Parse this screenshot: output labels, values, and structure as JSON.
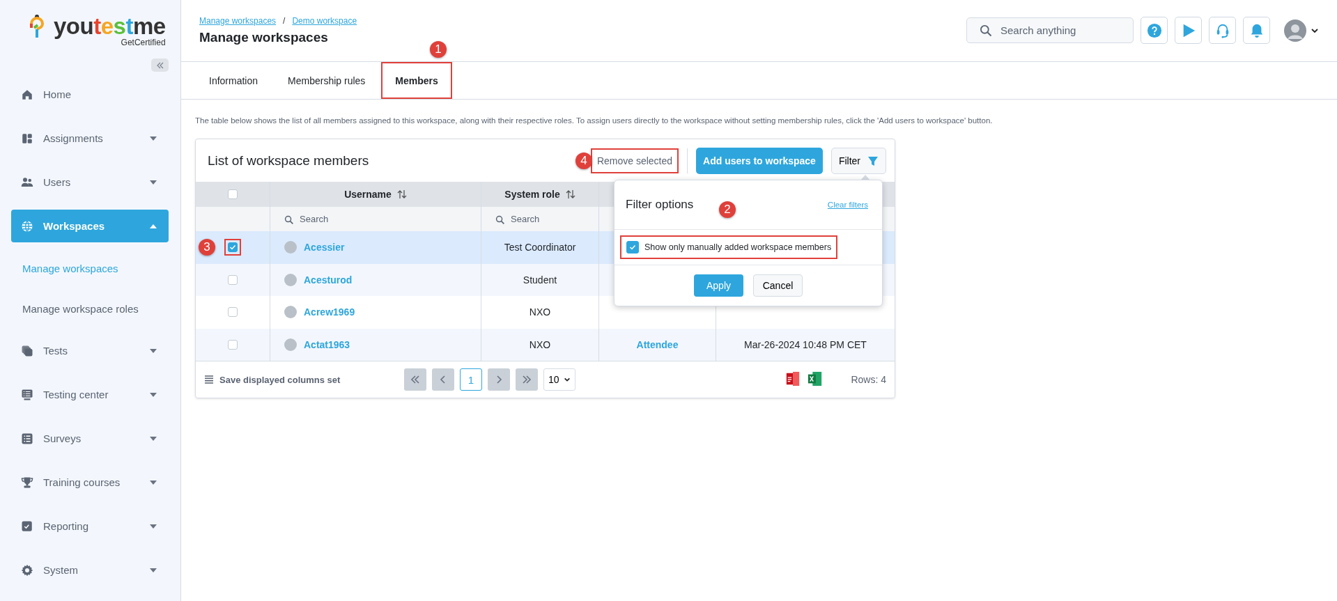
{
  "sidebar": {
    "logo": {
      "wordmark": "youtestme",
      "tagline": "GetCertified"
    },
    "items": [
      {
        "label": "Home",
        "selected": false
      },
      {
        "label": "Assignments",
        "selected": false,
        "expanded": false
      },
      {
        "label": "Users",
        "selected": false,
        "expanded": false
      },
      {
        "label": "Workspaces",
        "selected": true,
        "expanded": true,
        "children": [
          {
            "label": "Manage workspaces",
            "selected": true
          },
          {
            "label": "Manage workspace roles",
            "selected": false
          }
        ]
      },
      {
        "label": "Tests",
        "selected": false,
        "expanded": false
      },
      {
        "label": "Testing center",
        "selected": false,
        "expanded": false
      },
      {
        "label": "Surveys",
        "selected": false,
        "expanded": false
      },
      {
        "label": "Training courses",
        "selected": false,
        "expanded": false
      },
      {
        "label": "Reporting",
        "selected": false,
        "expanded": false
      },
      {
        "label": "System",
        "selected": false,
        "expanded": false
      }
    ]
  },
  "header": {
    "breadcrumbs": [
      "Manage workspaces",
      "Demo workspace"
    ],
    "separator": "/",
    "title": "Manage workspaces",
    "search": {
      "placeholder": "Search anything"
    }
  },
  "tabs": [
    {
      "label": "Information",
      "selected": false,
      "highlighted": false
    },
    {
      "label": "Membership rules",
      "selected": false,
      "highlighted": false
    },
    {
      "label": "Members",
      "selected": true,
      "highlighted": true
    }
  ],
  "description": "The table below shows the list of all members assigned to this workspace, along with their respective roles. To assign users directly to the workspace without setting membership rules, click the 'Add users to workspace' button.",
  "members_card": {
    "title": "List of workspace members",
    "remove_button": {
      "label": "Remove selected",
      "highlighted": true
    },
    "add_button": "Add users to workspace",
    "filter_button": "Filter",
    "table": {
      "header_checkbox": {
        "checked": false
      },
      "columns": [
        {
          "label": "Username",
          "sortable": true,
          "search_placeholder": "Search"
        },
        {
          "label": "System role",
          "sortable": true,
          "search_placeholder": "Search"
        }
      ],
      "rows": [
        {
          "checked": true,
          "selected": true,
          "highlighted": true,
          "username": "Acessier",
          "system_role": "Test Coordinator"
        },
        {
          "checked": false,
          "selected": false,
          "highlighted": false,
          "username": "Acesturod",
          "system_role": "Student"
        },
        {
          "checked": false,
          "selected": false,
          "highlighted": false,
          "username": "Acrew1969",
          "system_role": "NXO"
        },
        {
          "checked": false,
          "selected": false,
          "highlighted": false,
          "username": "Actat1963",
          "system_role": "NXO",
          "column_4": "Attendee",
          "column_5": "Mar-26-2024 10:48 PM CET"
        }
      ]
    },
    "footer": {
      "save_columns": "Save displayed columns set",
      "page": "1",
      "page_size": "10",
      "rows_count": "Rows: 4"
    }
  },
  "filter_popup": {
    "title": "Filter options",
    "clear_link": "Clear filters",
    "options": [
      {
        "label": "Show only manually added workspace members",
        "checked": true,
        "highlighted": true
      }
    ],
    "apply": "Apply",
    "cancel": "Cancel"
  },
  "annotations": [
    "1",
    "2",
    "3",
    "4"
  ]
}
